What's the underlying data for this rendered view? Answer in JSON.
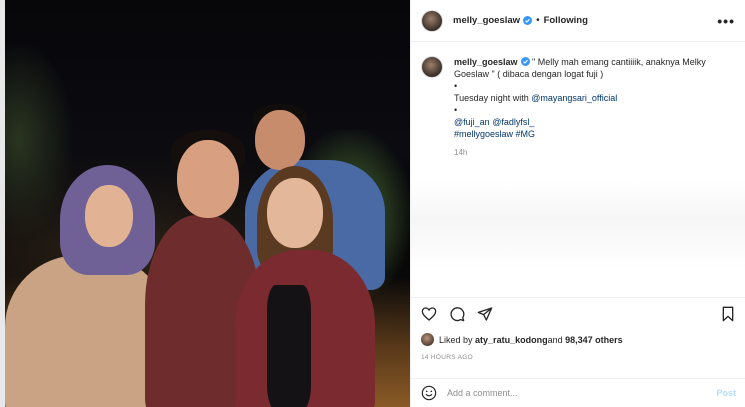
{
  "header": {
    "username": "melly_goeslaw",
    "separator": "•",
    "follow_status": "Following",
    "more": "•••"
  },
  "caption": {
    "username": "melly_goeslaw",
    "line1": " \" Melly mah emang cantiiiik, anaknya Melky Goeslaw \" ( dibaca dengan logat fuji )",
    "bullet1": "•",
    "line2_prefix": "Tuesday night with ",
    "line2_mention": "@mayangsari_official",
    "bullet2": "•",
    "mention3": "@fuji_an",
    "mention4": "@fadlyfsl_",
    "tag1": "#mellygoeslaw",
    "tag2": "#MG",
    "age": "14h"
  },
  "likes": {
    "prefix": "Liked by ",
    "user": "aty_ratu_kodong",
    "middle": " and ",
    "count": "98,347 others"
  },
  "post_time": "14 HOURS AGO",
  "comment": {
    "placeholder": "Add a comment...",
    "post_label": "Post"
  },
  "icons": {
    "like": "heart-icon",
    "comment": "comment-icon",
    "share": "share-icon",
    "save": "bookmark-icon",
    "emoji": "emoji-icon",
    "verified": "verified-badge-icon"
  },
  "colors": {
    "verified": "#3897f0",
    "mention": "#00376b",
    "post_disabled": "#b2dffc",
    "muted": "#8e8e8e"
  }
}
